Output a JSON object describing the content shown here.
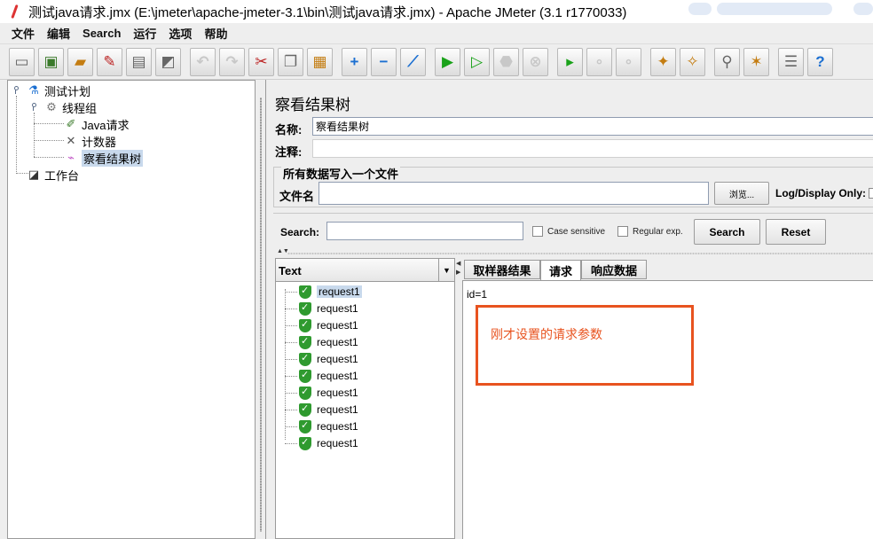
{
  "window": {
    "title": "测试java请求.jmx (E:\\jmeter\\apache-jmeter-3.1\\bin\\测试java请求.jmx) - Apache JMeter (3.1 r1770033)"
  },
  "menu": [
    "文件",
    "编辑",
    "Search",
    "运行",
    "选项",
    "帮助"
  ],
  "toolbar": {
    "icons": [
      "new-icon",
      "templates-icon",
      "open-icon",
      "close-icon",
      "save-icon",
      "save-as-icon",
      "undo-icon",
      "redo-icon",
      "cut-icon",
      "copy-icon",
      "paste-icon",
      "expand-icon",
      "collapse-icon",
      "toggle-icon",
      "start-icon",
      "start-no-timers-icon",
      "stop-icon",
      "shutdown-icon",
      "remote-start-icon",
      "remote-stop-icon",
      "remote-shutdown-icon",
      "clear-icon",
      "clear-all-icon",
      "search-icon",
      "reset-search-icon",
      "function-helper-icon",
      "help-icon"
    ]
  },
  "tree": {
    "nodes": [
      {
        "label": "测试计划",
        "icon": "test-plan-icon"
      },
      {
        "label": "线程组",
        "icon": "thread-group-icon"
      },
      {
        "label": "Java请求",
        "icon": "java-request-icon"
      },
      {
        "label": "计数器",
        "icon": "counter-icon"
      },
      {
        "label": "察看结果树",
        "icon": "results-tree-icon"
      },
      {
        "label": "工作台",
        "icon": "workbench-icon"
      }
    ]
  },
  "panel": {
    "title": "察看结果树",
    "name_label": "名称:",
    "name_value": "察看结果树",
    "comment_label": "注释:",
    "comment_value": "",
    "file_group_title": "所有数据写入一个文件",
    "filename_label": "文件名",
    "filename_value": "",
    "browse_label": "浏览...",
    "log_display_label": "Log/Display Only:"
  },
  "search": {
    "label": "Search:",
    "value": "",
    "case_sensitive_label": "Case sensitive",
    "regex_label": "Regular exp.",
    "search_button": "Search",
    "reset_button": "Reset"
  },
  "results": {
    "renderer": "Text",
    "items": [
      "request1",
      "request1",
      "request1",
      "request1",
      "request1",
      "request1",
      "request1",
      "request1",
      "request1",
      "request1"
    ]
  },
  "tabs": [
    "取样器结果",
    "请求",
    "响应数据"
  ],
  "request_body": "id=1",
  "annotation": {
    "text": "刚才设置的请求参数",
    "color": "#e8531f"
  },
  "colors": {
    "selection": "#c8d9ec",
    "success": "#2f9a2f"
  }
}
